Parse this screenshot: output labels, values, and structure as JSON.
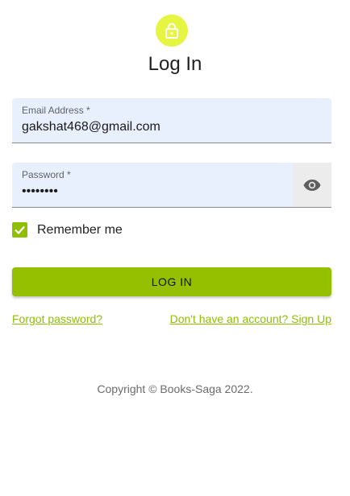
{
  "header": {
    "title": "Log In",
    "avatar_icon": "lock-icon",
    "avatar_color": "#e6f542"
  },
  "form": {
    "email": {
      "label": "Email Address *",
      "value": "gakshat468@gmail.com"
    },
    "password": {
      "label": "Password *",
      "value": "••••••••",
      "toggle_icon": "eye-icon"
    },
    "remember": {
      "label": "Remember me",
      "checked": true
    },
    "submit_label": "LOG IN"
  },
  "links": {
    "forgot": "Forgot password?",
    "signup": "Don't have an account? Sign Up"
  },
  "footer": {
    "copyright": "Copyright © Books-Saga 2022."
  },
  "colors": {
    "accent": "#94c000",
    "field_bg": "#e8f0fe"
  }
}
